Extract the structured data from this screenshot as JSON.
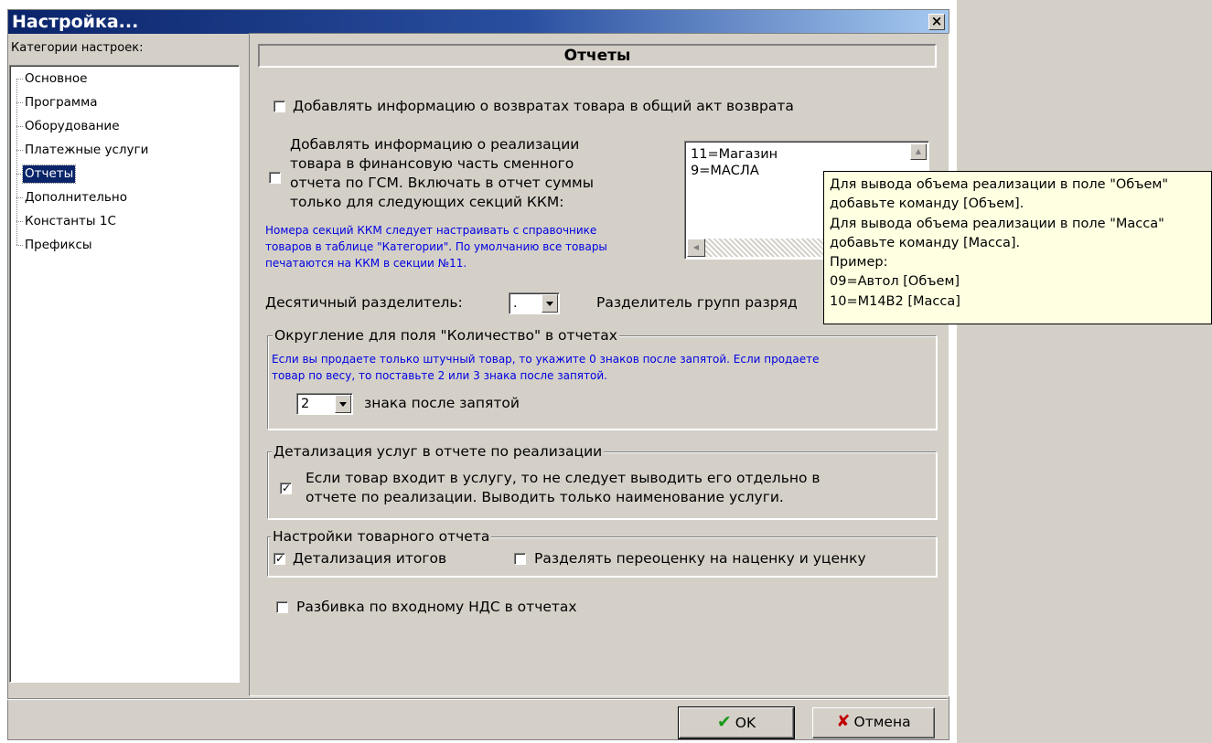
{
  "window": {
    "title": "Настройка...",
    "close_glyph": "×"
  },
  "sidebar": {
    "label": "Категории настроек:",
    "items": [
      {
        "label": "Основное"
      },
      {
        "label": "Программа"
      },
      {
        "label": "Оборудование"
      },
      {
        "label": "Платежные услуги"
      },
      {
        "label": "Отчеты",
        "selected": true
      },
      {
        "label": "Дополнительно"
      },
      {
        "label": "Константы 1С"
      },
      {
        "label": "Префиксы"
      }
    ]
  },
  "panel": {
    "title": "Отчеты",
    "add_returns_label": "Добавлять информацию о возвратах товара в общий акт возврата",
    "add_returns_checked": false,
    "add_sales_line1": "Добавлять информацию о реализации",
    "add_sales_line2": "товара в финансовую часть сменного",
    "add_sales_line3": "отчета по ГСМ. Включать в отчет суммы",
    "add_sales_line4": "только для следующих секций ККМ:",
    "add_sales_checked": false,
    "note_line1": "Номера секций ККМ следует настраивать с справочнике",
    "note_line2": "товаров в таблице \"Категории\". По умолчанию все товары",
    "note_line3": "печатаются на ККМ в секции №11.",
    "sections": [
      "11=Магазин",
      "9=МАСЛА"
    ],
    "decimal_sep_label": "Десятичный разделитель:",
    "decimal_sep_value": ".",
    "group_sep_label": "Разделитель групп разряд",
    "rounding": {
      "title": "Округление для поля \"Количество\" в отчетах",
      "note_line1": "Если вы продаете только штучный товар, то укажите 0 знаков после запятой. Если продаете",
      "note_line2": "товар по весу, то поставьте 2 или 3 знака после запятой.",
      "value": "2",
      "suffix": "знака после запятой"
    },
    "services": {
      "title": "Детализация услуг в отчете по реализации",
      "line1": "Если товар входит в услугу, то не следует выводить его отдельно в",
      "line2": "отчете по реализации. Выводить только наименование услуги.",
      "checked": true
    },
    "goods_report": {
      "title": "Настройки товарного отчета",
      "detail_label": "Детализация итогов",
      "detail_checked": true,
      "split_label": "Разделять переоценку на наценку и уценку",
      "split_checked": false
    },
    "vat_label": "Разбивка по входному НДС в отчетах",
    "vat_checked": false
  },
  "tooltip": {
    "line1": "Для вывода объема реализации в поле \"Объем\"",
    "line2": "добавьте команду [Объем].",
    "line3": "Для вывода объема реализации в поле \"Масса\"",
    "line4": "добавьте команду [Масса].",
    "line5": "Пример:",
    "line6": "09=Автол [Объем]",
    "line7": "10=М14В2 [Масса]"
  },
  "buttons": {
    "ok_label": "OK",
    "cancel_label": "Отмена"
  },
  "icons": {
    "ok": "check-icon",
    "cancel": "cross-icon"
  },
  "colors": {
    "titlebar": "#0a246a",
    "selection": "#0a246a",
    "note_text": "#0000e0",
    "tooltip_bg": "#ffffe1",
    "face": "#d4d0c8"
  }
}
